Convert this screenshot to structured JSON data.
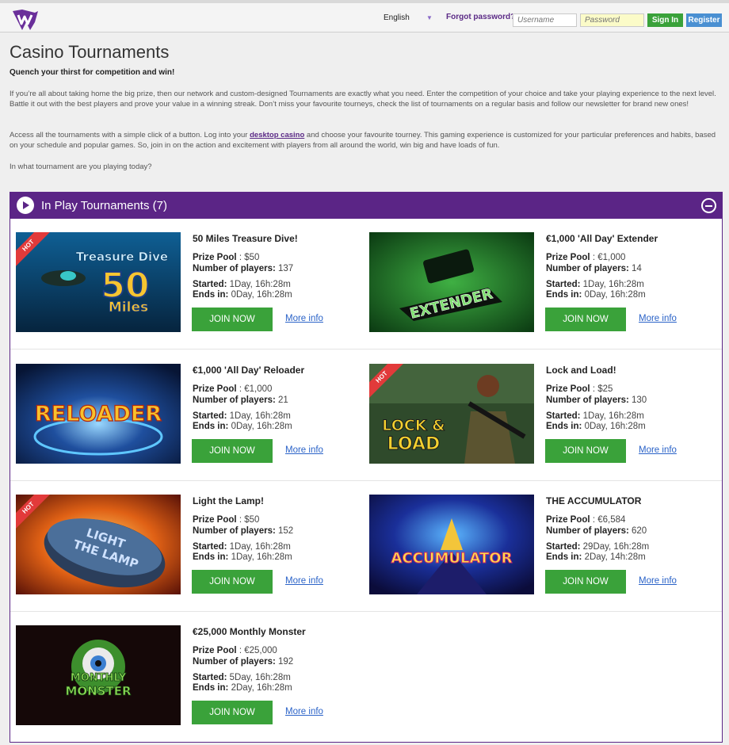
{
  "header": {
    "language": "English",
    "forgot_password": "Forgot password?",
    "username_placeholder": "Username",
    "password_placeholder": "Password",
    "sign_in": "Sign In",
    "register": "Register"
  },
  "intro": {
    "title": "Casino Tournaments",
    "subtitle": "Quench your thirst for competition and win!",
    "p1": "If you’re all about taking home the big prize, then our network and custom-designed Tournaments are exactly what you need. Enter the competition of your choice and take your playing experience to the next level. Battle it out with the best players and prove your value in a winning streak. Don’t miss your favourite tourneys, check the list of tournaments on a regular basis and follow our newsletter for brand new ones!",
    "p2_before": "Access all the tournaments with a simple click of a button. Log into your ",
    "p2_link": "desktop casino",
    "p2_after": " and choose your favourite tourney. This gaming experience is customized for your particular preferences and habits, based on your schedule and popular games. So, join in on the action and excitement with players from all around the world, win big and have loads of fun.",
    "p3": "In what tournament are you playing today?"
  },
  "panel": {
    "title": "In Play Tournaments (7)"
  },
  "labels": {
    "prize_pool": "Prize Pool",
    "players": "Number of players:",
    "started": "Started:",
    "ends": "Ends in:",
    "join": "JOIN NOW",
    "more": "More info",
    "hot": "HOT"
  },
  "tournaments": [
    {
      "name": "50 Miles Treasure Dive!",
      "prize": ": $50",
      "players": "137",
      "started": "1Day, 16h:28m",
      "ends": "0Day, 16h:28m",
      "hot": true,
      "art": "Treasure Dive 50 Miles"
    },
    {
      "name": "€1,000 'All Day' Extender",
      "prize": ": €1,000",
      "players": "14",
      "started": "1Day, 16h:28m",
      "ends": "0Day, 16h:28m",
      "hot": false,
      "art": "EXTENDER"
    },
    {
      "name": "€1,000 'All Day' Reloader",
      "prize": ": €1,000",
      "players": "21",
      "started": "1Day, 16h:28m",
      "ends": "0Day, 16h:28m",
      "hot": false,
      "art": "RELOADER"
    },
    {
      "name": "Lock and Load!",
      "prize": ": $25",
      "players": "130",
      "started": "1Day, 16h:28m",
      "ends": "0Day, 16h:28m",
      "hot": true,
      "art": "LOCK & LOAD"
    },
    {
      "name": "Light the Lamp!",
      "prize": ": $50",
      "players": "152",
      "started": "1Day, 16h:28m",
      "ends": "1Day, 16h:28m",
      "hot": true,
      "art": "LIGHT THE LAMP"
    },
    {
      "name": "THE ACCUMULATOR",
      "prize": ": €6,584",
      "players": "620",
      "started": "29Day, 16h:28m",
      "ends": "2Day, 14h:28m",
      "hot": false,
      "art": "ACCUMULATOR"
    },
    {
      "name": "€25,000 Monthly Monster",
      "prize": ": €25,000",
      "players": "192",
      "started": "5Day, 16h:28m",
      "ends": "2Day, 16h:28m",
      "hot": false,
      "art": "MONTHLY MONSTER"
    }
  ],
  "colors": {
    "brand_purple": "#5b2586",
    "join_green": "#3aa23a",
    "link_blue": "#2b63c8",
    "hot_red": "#e23a3a"
  }
}
